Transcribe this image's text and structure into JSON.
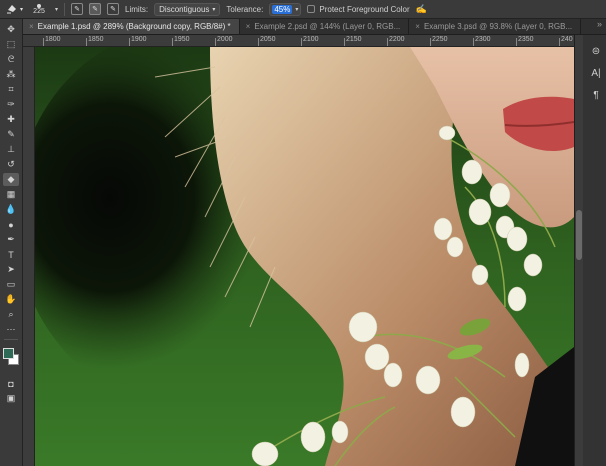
{
  "options_bar": {
    "brush_size": "225",
    "limits_label": "Limits:",
    "limits_value": "Discontiguous",
    "tolerance_label": "Tolerance:",
    "tolerance_value": "45%",
    "protect_label": "Protect Foreground Color"
  },
  "tabs": [
    {
      "label": "Example 1.psd @ 289% (Background copy, RGB/8#) *",
      "active": true
    },
    {
      "label": "Example 2.psd @ 144% (Layer 0, RGB...",
      "active": false
    },
    {
      "label": "Example 3.psd @ 93.8% (Layer 0, RGB...",
      "active": false
    }
  ],
  "tabs_more": "»",
  "ruler": {
    "labels": [
      "1800",
      "1850",
      "1900",
      "1950",
      "2000",
      "2050",
      "2100",
      "2150",
      "2200",
      "2250",
      "2300",
      "2350",
      "240"
    ]
  },
  "colors": {
    "foreground": "#2f6a56",
    "background": "#ffffff",
    "accent": "#2a6fd6"
  },
  "toolbar_icons": [
    "move-icon",
    "marquee-icon",
    "lasso-icon",
    "magic-wand-icon",
    "crop-icon",
    "eyedropper-icon",
    "healing-icon",
    "brush-icon",
    "clone-stamp-icon",
    "history-brush-icon",
    "background-eraser-icon",
    "gradient-icon",
    "blur-icon",
    "dodge-icon",
    "pen-icon",
    "type-icon",
    "path-select-icon",
    "rectangle-icon",
    "hand-icon",
    "zoom-icon",
    "more-icon"
  ],
  "panel_icons": [
    "adjust-icon",
    "character-icon",
    "paragraph-icon"
  ]
}
